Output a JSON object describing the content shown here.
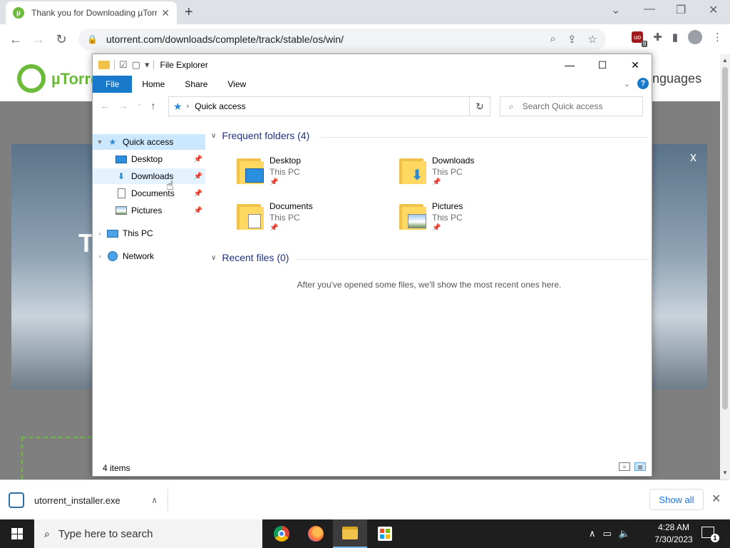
{
  "browser": {
    "tab_title": "Thank you for Downloading µTorrent",
    "tab_close": "✕",
    "new_tab": "+",
    "url": "utorrent.com/downloads/complete/track/stable/os/win/",
    "extension_badge": "9"
  },
  "webpage": {
    "logo_text": "µTorre",
    "languages_text": "nguages",
    "hero_close": "x",
    "hero_heading_fragment": "T"
  },
  "explorer": {
    "title": "File Explorer",
    "ribbon_tabs": [
      "File",
      "Home",
      "Share",
      "View"
    ],
    "address_path": "Quick access",
    "search_placeholder": "Search Quick access",
    "help": "?",
    "nav": {
      "quick_access": "Quick access",
      "desktop": "Desktop",
      "downloads": "Downloads",
      "documents": "Documents",
      "pictures": "Pictures",
      "this_pc": "This PC",
      "network": "Network"
    },
    "frequent_header": "Frequent folders (4)",
    "folders": [
      {
        "name": "Desktop",
        "location": "This PC"
      },
      {
        "name": "Downloads",
        "location": "This PC"
      },
      {
        "name": "Documents",
        "location": "This PC"
      },
      {
        "name": "Pictures",
        "location": "This PC"
      }
    ],
    "recent_header": "Recent files (0)",
    "recent_message": "After you've opened some files, we'll show the most recent ones here.",
    "status": "4 items"
  },
  "download_bar": {
    "filename": "utorrent_installer.exe",
    "show_all": "Show all"
  },
  "taskbar": {
    "search_placeholder": "Type here to search",
    "time": "4:28 AM",
    "date": "7/30/2023",
    "notification_count": "1"
  },
  "colors": {
    "utorrent_green": "#6cba3a",
    "file_tab_blue": "#1979ca",
    "selection_blue": "#cce8ff",
    "group_header": "#1e3287"
  }
}
